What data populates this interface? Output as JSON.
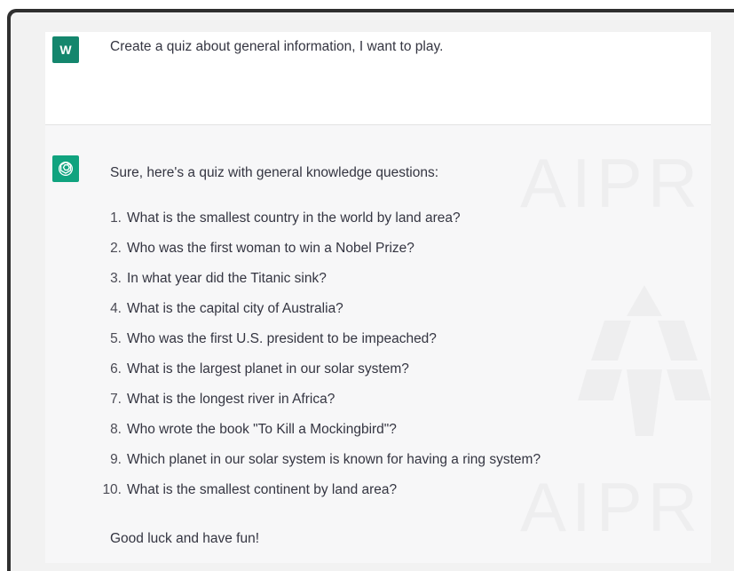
{
  "user": {
    "avatar_letter": "W",
    "message": "Create a quiz about general information, I want to play."
  },
  "assistant": {
    "avatar_icon": "openai-logo-icon",
    "intro": "Sure, here's a quiz with general knowledge questions:",
    "questions": [
      {
        "number": "1.",
        "text": "What is the smallest country in the world by land area?"
      },
      {
        "number": "2.",
        "text": "Who was the first woman to win a Nobel Prize?"
      },
      {
        "number": "3.",
        "text": "In what year did the Titanic sink?"
      },
      {
        "number": "4.",
        "text": "What is the capital city of Australia?"
      },
      {
        "number": "5.",
        "text": "Who was the first U.S. president to be impeached?"
      },
      {
        "number": "6.",
        "text": "What is the largest planet in our solar system?"
      },
      {
        "number": "7.",
        "text": "What is the longest river in Africa?"
      },
      {
        "number": "8.",
        "text": "Who wrote the book \"To Kill a Mockingbird\"?"
      },
      {
        "number": "9.",
        "text": "Which planet in our solar system is known for having a ring system?"
      },
      {
        "number": "10.",
        "text": "What is the smallest continent by land area?"
      }
    ],
    "closing": "Good luck and have fun!"
  },
  "watermark": {
    "text_top": "AIPR",
    "text_bottom": "AIPR"
  },
  "colors": {
    "user_avatar": "#14866d",
    "assistant_avatar": "#10a37f",
    "frame": "#2f2f2f",
    "assistant_bg": "#f7f7f8",
    "text": "#343541"
  }
}
